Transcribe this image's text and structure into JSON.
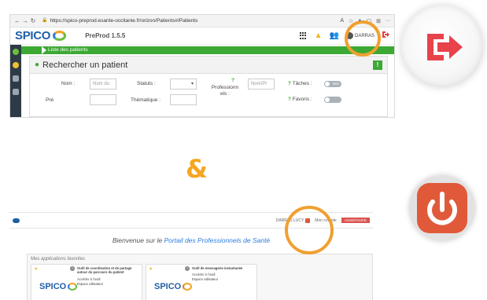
{
  "top_screenshot": {
    "browser": {
      "url": "https://spico-preprod.esante-occitanie.fr/orizon/Patients#/Patients",
      "more_label": "···"
    },
    "header": {
      "logo_text": "SPICO",
      "version": "PreProd 1.5.5",
      "user_name": "DARRAS"
    },
    "breadcrumb": "Liste des patients",
    "panel_title": "Rechercher un patient",
    "form": {
      "nom_label": "Nom :",
      "nom_placeholder": "Nom du",
      "statuts_label": "Statuts :",
      "professionnels_label": "Professionn els :",
      "professionnels_placeholder": "Nom/Pr",
      "taches_label": "Tâches :",
      "favoris_label": "Favoris :",
      "thematique_label": "Thématique :",
      "toggle_label": "Non"
    }
  },
  "ampersand": "&",
  "bottom_screenshot": {
    "user_label": "DARRAS LUCY",
    "nav_label": "Mon compte",
    "help_button": "ASSISTANCE",
    "welcome_prefix": "Bienvenue sur le ",
    "welcome_highlight": "Portail des Professionnels de Santé",
    "favorites_title": "Mes applications favorites",
    "cards": [
      {
        "title": "Outil de coordination et de partage autour du parcours du patient",
        "link1": "Accéder à l'outil",
        "link2": "Espace utilisateur",
        "logo": "SPICO"
      },
      {
        "title": "Outil de messagerie instantanée",
        "link1": "Accéder à l'outil",
        "link2": "Espace utilisateur",
        "logo": "SPICO"
      }
    ]
  },
  "icons": {
    "logout": "logout-arrow-icon",
    "power": "power-icon"
  },
  "colors": {
    "highlight": "#f0a030",
    "logout_red": "#e8424a",
    "power_orange": "#e05a3a",
    "spico_green": "#3da935"
  }
}
